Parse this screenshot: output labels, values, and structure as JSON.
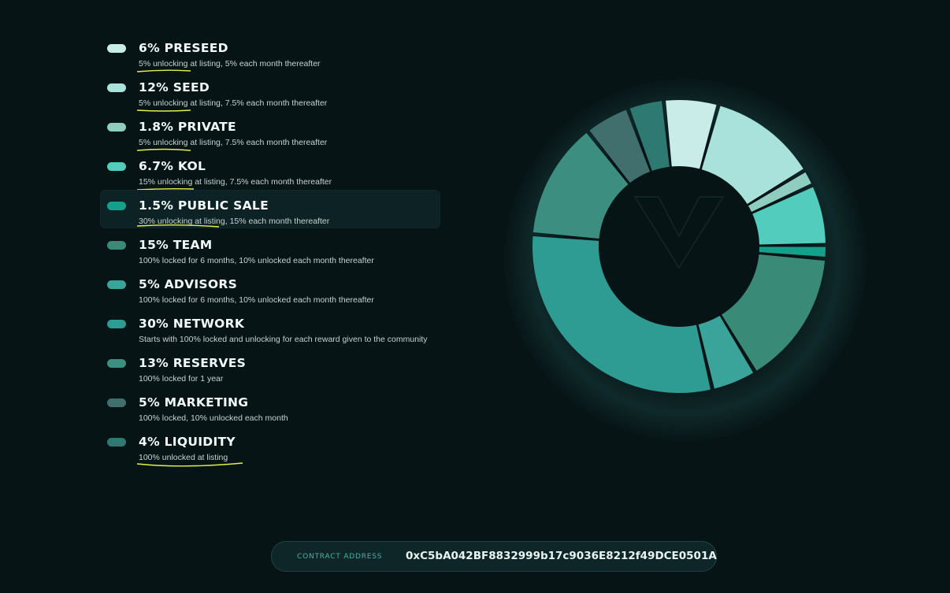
{
  "legend": [
    {
      "title": "6% PRESEED",
      "desc": "5% unlocking at listing, 5% each month thereafter",
      "color": "#c9ece8"
    },
    {
      "title": "12% SEED",
      "desc": "5% unlocking at listing, 7.5% each month thereafter",
      "color": "#a8e2da"
    },
    {
      "title": "1.8% PRIVATE",
      "desc": "5% unlocking at listing, 7.5% each month thereafter",
      "color": "#8fcdc1"
    },
    {
      "title": "6.7% KOL",
      "desc": "15% unlocking at listing, 7.5% each month thereafter",
      "color": "#52cdbd"
    },
    {
      "title": "1.5% PUBLIC SALE",
      "desc": "30% unlocking at listing, 15% each month thereafter",
      "color": "#14a08a"
    },
    {
      "title": "15% TEAM",
      "desc": "100% locked for 6 months, 10% unlocked each month thereafter",
      "color": "#3a8a78"
    },
    {
      "title": "5% ADVISORS",
      "desc": "100% locked for 6 months, 10% unlocked each month thereafter",
      "color": "#3aa39a"
    },
    {
      "title": "30% NETWORK",
      "desc": "Starts with 100% locked and unlocking for each reward given to the community",
      "color": "#2f9c93"
    },
    {
      "title": "13% RESERVES",
      "desc": "100% locked for 1 year",
      "color": "#3c8f80"
    },
    {
      "title": "5% MARKETING",
      "desc": "100% locked, 10% unlocked each month",
      "color": "#406f6e"
    },
    {
      "title": "4% LIQUIDITY",
      "desc": "100% unlocked at listing",
      "color": "#2e7a72"
    }
  ],
  "chart_data": {
    "type": "pie",
    "categories": [
      "PRESEED",
      "SEED",
      "PRIVATE",
      "KOL",
      "PUBLIC SALE",
      "TEAM",
      "ADVISORS",
      "NETWORK",
      "RESERVES",
      "MARKETING",
      "LIQUIDITY"
    ],
    "values": [
      6,
      12,
      1.8,
      6.7,
      1.5,
      15,
      5,
      30,
      13,
      5,
      4
    ],
    "colors": [
      "#c9ece8",
      "#a8e2da",
      "#8fcdc1",
      "#52cdbd",
      "#14a08a",
      "#3a8a78",
      "#3aa39a",
      "#2f9c93",
      "#3c8f80",
      "#406f6e",
      "#2e7a72"
    ]
  },
  "contract": {
    "label": "CONTRACT ADDRESS",
    "value": "0xC5bA042BF8832999b17c9036E8212f49DCE0501A"
  }
}
